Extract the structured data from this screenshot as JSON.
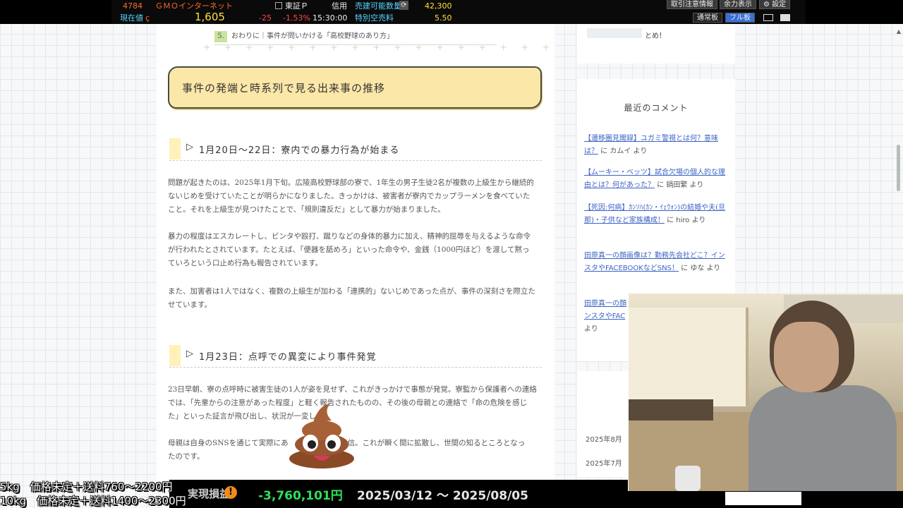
{
  "ticker": {
    "code": "4784",
    "company": "ＧＭＯインターネット",
    "market": "東証Ｐ",
    "margin": "信用",
    "sell_qty_label": "売建可能数量",
    "sell_qty_value": "42,300",
    "current_label": "現在値",
    "current_price": "1,605",
    "change": "-25",
    "change_pct": "-1.53%",
    "time": "15:30:00",
    "fee_label": "特別空売料",
    "fee_value": "5.50",
    "btn_notice": "取引注意情報",
    "btn_power": "余力表示",
    "btn_settings": "設定",
    "btn_normal": "通常板",
    "btn_full": "フル板"
  },
  "article": {
    "toc_num": "5.",
    "toc_text": "おわりに｜事件が問いかける「高校野球のあり方」",
    "main_heading": "事件の発端と時系列で見る出来事の推移",
    "section1_heading": "1月20日〜22日：寮内での暴力行為が始まる",
    "p1_l1": "問題が起きたのは、2025年1月下旬。広陵高校野球部の寮で、1年生の男子生徒2名が複数の上級生から継続的",
    "p1_l2": "ないじめを受けていたことが明らかになりました。きっかけは、被害者が寮内でカップラーメンを食べていた",
    "p1_l3": "こと。それを上級生が見つけたことで、「規則違反だ」として暴力が始まりました。",
    "p2_l1": "暴力の程度はエスカレートし、ビンタや殴打、蹴りなどの身体的暴力に加え、精神的屈辱を与えるような命令",
    "p2_l2": "が行われたとされています。たとえば、「便器を舐めろ」といった命令や、金銭（1000円ほど）を渡して黙っ",
    "p2_l3": "ていろという口止め行為も報告されています。",
    "p3_l1": "また、加害者は1人ではなく、複数の上級生が加わる「連携的」ないじめであった点が、事件の深刻さを際立た",
    "p3_l2": "せています。",
    "section2_heading": "1月23日：点呼での異変により事件発覚",
    "p4_l1": "23日早朝、寮の点呼時に被害生徒の1人が姿を見せず、これがきっかけで事態が発覚。寮監から保護者への連絡",
    "p4_l2": "では、「先輩からの注意があった程度」と軽く報告されたものの、その後の母親との連絡で「命の危険を感じ",
    "p4_l3": "た」といった証言が飛び出し、状況が一変しま",
    "p5_l1": "母親は自身のSNSを通じて実際にあ　　　　　　を発信。これが瞬く間に拡散し、世間の知るところとなっ",
    "p5_l2": "たのです。"
  },
  "sidebar": {
    "top_text": "とめ！",
    "comments_title": "最近のコメント",
    "comments": [
      {
        "link": "【還移圏見聞録】ユガミ警視とは何？意味は？",
        "by": " に カムイ より"
      },
      {
        "link": "【ムーキー・ベッツ】試合欠場の個人的な理由とは？何があった？",
        "by": " に 鍋田繁 より"
      },
      {
        "link": "【死因:何病】ｶﾝｿﾊ(ｶﾝ・ｲｪｳｫﾝ)の結婚や夫(旦那)・子供など家族構成！",
        "by": " に hiro より"
      },
      {
        "link": "田原真一の顔画像は？勤務先会社どこ？インスタやFACEBOOKなどSNS！",
        "by": " に ゆな より"
      },
      {
        "link": "田原真一の顔",
        "link2": "ンスタやFAC",
        "by": "より"
      }
    ],
    "archive": [
      "2025年8月",
      "2025年7月"
    ]
  },
  "overlay": {
    "price_line1": "5kg　価格未定＋送料760～2200円",
    "price_line2": "10kg　価格未定＋送料1400～2300円",
    "pnl_label": "実現損益",
    "pnl_icon": "!",
    "pnl_value": "-3,760,101円",
    "pnl_period": "2025/03/12 ～ 2025/08/05"
  },
  "colors": {
    "heading_fill": "#fbe7a8",
    "link": "#3b62c4",
    "pnl_negative": "#2fe05a",
    "ticker_orange": "#ff6a2a"
  }
}
